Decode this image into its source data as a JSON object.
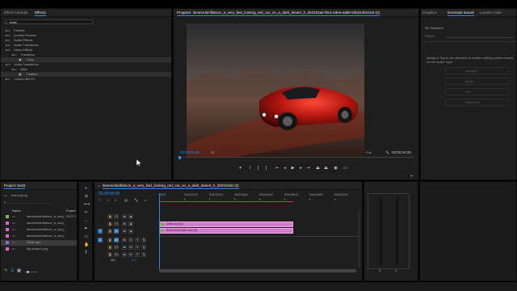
{
  "effects_panel": {
    "tabs": [
      "Effect Controls",
      "Effects"
    ],
    "search_value": "feath",
    "tree": [
      {
        "label": "Presets",
        "level": 0
      },
      {
        "label": "Lumetri Presets",
        "level": 0
      },
      {
        "label": "Audio Effects",
        "level": 0
      },
      {
        "label": "Audio Transitions",
        "level": 0
      },
      {
        "label": "Video Effects",
        "level": 0
      },
      {
        "label": "Transform",
        "level": 1
      },
      {
        "label": "Crop",
        "level": 2
      },
      {
        "label": "Video Transitions",
        "level": 0
      },
      {
        "label": "Wipe",
        "level": 1
      },
      {
        "label": "Feather",
        "level": 2
      },
      {
        "label": "Custom Bin 01",
        "level": 0
      }
    ]
  },
  "program_monitor": {
    "title": "Program: lamesrobinflatcon_a_very_fast_looking_red_car_on_a_dark_desert_h_2b01b2ab-f8c4-4de6-ad89-92bd14f2c0c8 (2)",
    "timecode_left": "00;00;00;00",
    "fit_label": "Fit",
    "quality_label": "Full",
    "timecode_right": "00;00;04;29"
  },
  "essential_sound": {
    "tabs": [
      "Graphics",
      "Essential Sound",
      "Lumetri Color"
    ],
    "no_selection": "No Selection",
    "preset_label": "Preset:",
    "hint": "Assign a Tag to the selection to enable editing options based on the Audio Type.",
    "buttons": [
      "Dialogue",
      "Music",
      "SFX",
      "Ambience"
    ]
  },
  "project_panel": {
    "title": "Project: test3",
    "file_label": "test3.prproj",
    "columns": [
      "Name",
      "Frame"
    ],
    "items": [
      {
        "name": "lamesrobinflatcon_a_very_",
        "frame": "29,97 f",
        "color": "#7cc04f"
      },
      {
        "name": "lamesrobinflatcon_a_very_",
        "frame": "",
        "color": "#d36bd0"
      },
      {
        "name": "lamesrobinflatcon_a_very_",
        "frame": "",
        "color": "#d36bd0"
      },
      {
        "name": "lamesrobinflatcon_a_very_",
        "frame": "",
        "color": "#d36bd0"
      },
      {
        "name": "DUB.mp4",
        "frame": "",
        "color": "#8a6ed8"
      },
      {
        "name": "My project.png",
        "frame": "",
        "color": "#d36bd0"
      }
    ]
  },
  "timeline": {
    "title": "lamesrobinflatcon_a_very_fast_looking_red_car_on_a_dark_desert_h_2b01b2ab (2)",
    "timecode": "00;00;00;00",
    "ruler": [
      "00;00",
      "00;00;01;00",
      "00;00;02;00",
      "00;00;03;00",
      "00;00;04;00",
      "00;00;05;00",
      "00;00;06;00",
      "00;00;07;00"
    ],
    "tracks": [
      "V3",
      "V2",
      "V1",
      "A1",
      "A2",
      "A3"
    ],
    "clips": [
      {
        "label": "DUB.mp4 [V]",
        "color": "#d77bd0"
      },
      {
        "label": "BACKGROUND.mp4 [V]",
        "color": "#d77bd0"
      }
    ],
    "mix_label": "Mix",
    "mix_value": "0.0"
  },
  "accent_color": "#2d8ceb"
}
